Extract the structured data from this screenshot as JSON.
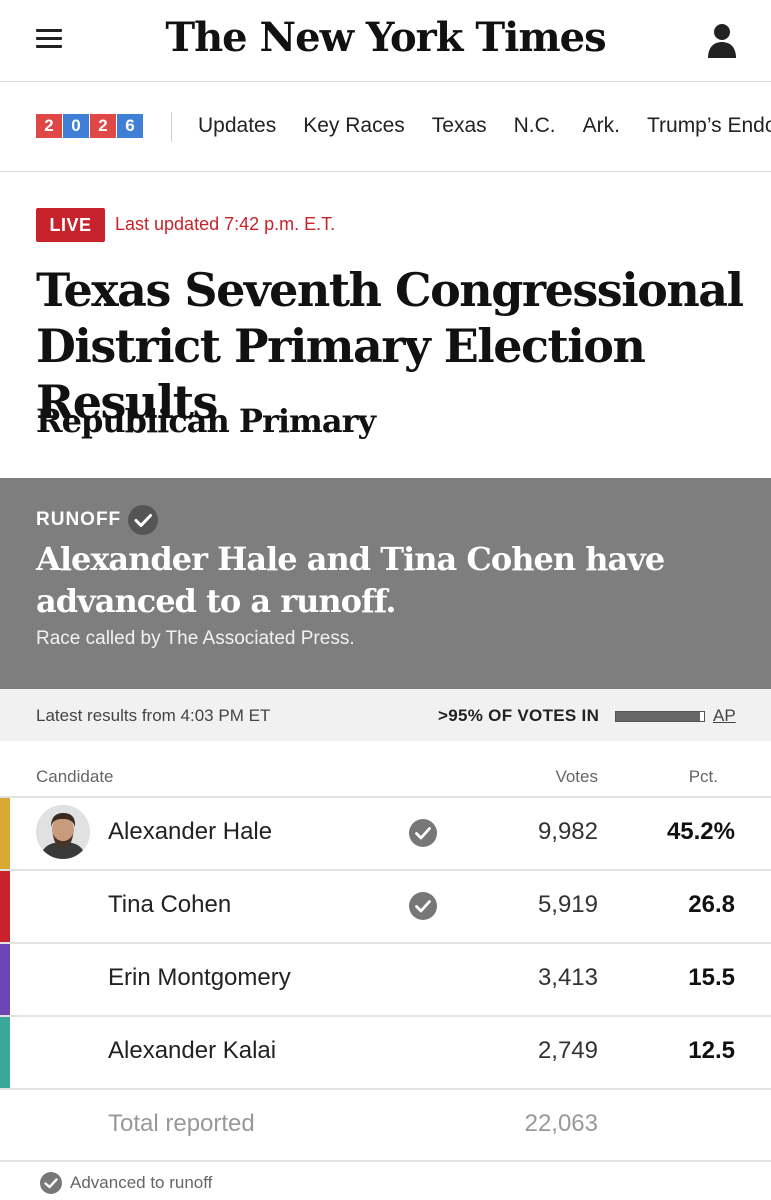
{
  "header": {
    "logo_text": "The New York Times",
    "menu_icon": "hamburger-menu-icon",
    "user_icon": "user-account-icon"
  },
  "nav": {
    "year_digits": [
      "2",
      "0",
      "2",
      "6"
    ],
    "year_colors": [
      "#e04848",
      "#3f7fd6",
      "#e04848",
      "#3f7fd6"
    ],
    "items": [
      "Updates",
      "Key Races",
      "Texas",
      "N.C.",
      "Ark.",
      "Trump’s Endorsements"
    ]
  },
  "live": {
    "badge": "LIVE",
    "last_updated": "Last updated 7:42 p.m. E.T."
  },
  "page": {
    "title": "Texas Seventh Congressional District Primary Election Results",
    "subtitle": "Republican Primary"
  },
  "runoff": {
    "label": "RUNOFF",
    "headline": "Alexander Hale and Tina Cohen have advanced to a runoff.",
    "called_by": "Race called by The Associated Press."
  },
  "results": {
    "latest": "Latest results from 4:03 PM ET",
    "votes_in": ">95% OF VOTES IN",
    "votes_in_fraction": 0.96,
    "source": "AP"
  },
  "table": {
    "headers": {
      "candidate": "Candidate",
      "votes": "Votes",
      "pct": "Pct."
    },
    "rows": [
      {
        "name": "Alexander Hale",
        "votes": "9,982",
        "pct": "45.2%",
        "advanced": true,
        "color": "#d9a934",
        "photo": true
      },
      {
        "name": "Tina Cohen",
        "votes": "5,919",
        "pct": "26.8",
        "advanced": true,
        "color": "#c8232c",
        "photo": false
      },
      {
        "name": "Erin Montgomery",
        "votes": "3,413",
        "pct": "15.5",
        "advanced": false,
        "color": "#6d45b5",
        "photo": false
      },
      {
        "name": "Alexander Kalai",
        "votes": "2,749",
        "pct": "12.5",
        "advanced": false,
        "color": "#3aa69c",
        "photo": false
      }
    ],
    "total_label": "Total reported",
    "total_votes": "22,063"
  },
  "legend": {
    "text": "Advanced to runoff",
    "icon": "check-circle-icon"
  }
}
